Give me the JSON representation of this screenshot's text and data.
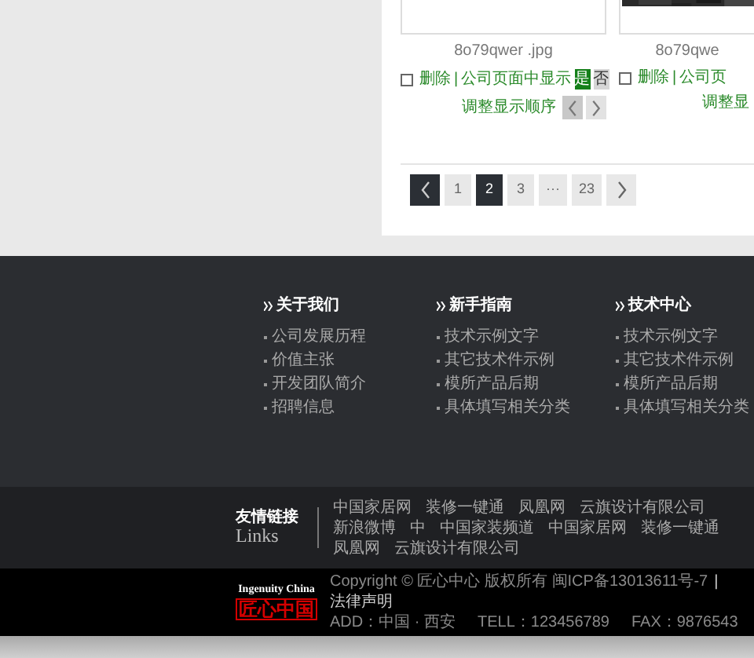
{
  "cards": [
    {
      "kind": "full",
      "filename": "8o79qwer .jpg",
      "checked": false,
      "delete": "删除",
      "separator": "|",
      "show_label": "公司页面中显示",
      "options": [
        {
          "label": "是",
          "selected": true
        },
        {
          "label": "否",
          "selected": false
        }
      ],
      "order_label": "调整显示顺序"
    },
    {
      "kind": "partial",
      "filename": "8o79qwe",
      "checked": false,
      "delete": "删除",
      "separator": "|",
      "show_label": "公司页",
      "order_label": "调整显"
    }
  ],
  "pagination": [
    {
      "kind": "prev",
      "selected": false
    },
    {
      "kind": "page",
      "label": "1",
      "selected": false
    },
    {
      "kind": "page",
      "label": "2",
      "selected": true
    },
    {
      "kind": "page",
      "label": "3",
      "selected": false
    },
    {
      "kind": "ellipsis",
      "label": "···",
      "selected": false
    },
    {
      "kind": "page",
      "label": "23",
      "selected": false
    },
    {
      "kind": "next",
      "selected": false
    }
  ],
  "footer_columns": [
    {
      "title": "关于我们",
      "items": [
        "公司发展历程",
        "价值主张",
        "开发团队简介",
        "招聘信息"
      ]
    },
    {
      "title": "新手指南",
      "items": [
        "技术示例文字",
        "其它技术件示例",
        "模所产品后期",
        "具体填写相关分类"
      ]
    },
    {
      "title": "技术中心",
      "items": [
        "技术示例文字",
        "其它技术件示例",
        "模所产品后期",
        "具体填写相关分类"
      ]
    }
  ],
  "links": {
    "title": "友情链接",
    "subtitle": "Links",
    "items": [
      "中国家居网",
      "装修一键通",
      "凤凰网",
      "云旗设计有限公司",
      "新浪微博",
      "中",
      "中国家装频道",
      "中国家居网",
      "装修一键通",
      "凤凰网",
      "云旗设计有限公司"
    ]
  },
  "bottom": {
    "logo_top": "Ingenuity China",
    "logo_mark": "匠心中国",
    "copyright": "Copyright © 匠心中心 版权所有 闽ICP备13013611号-7",
    "separator": "|",
    "legal": "法律声明",
    "contact": [
      "ADD：中国 · 西安",
      "TELL：123456789",
      "FAX：9876543"
    ]
  }
}
